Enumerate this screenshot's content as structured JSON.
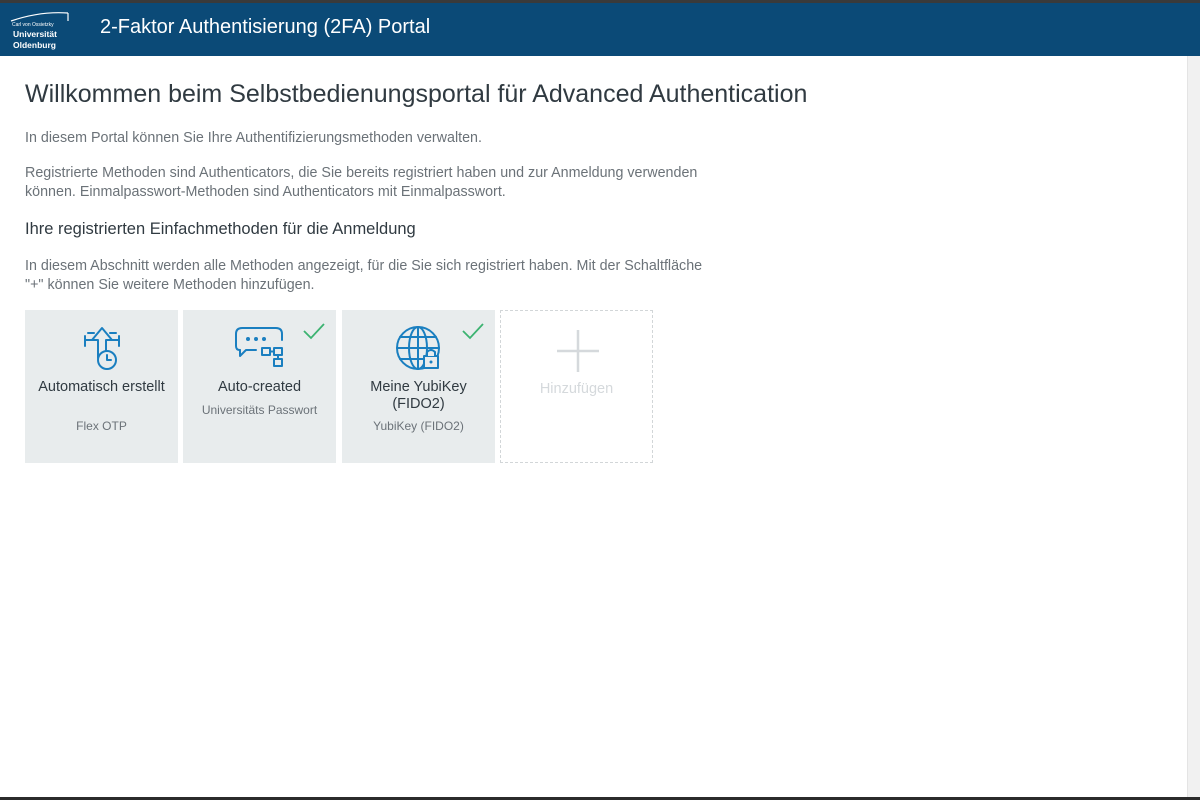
{
  "header": {
    "logo": {
      "line1": "Carl von Ossietzky",
      "line2": "Universität",
      "line3": "Oldenburg"
    },
    "title": "2-Faktor Authentisierung (2FA) Portal"
  },
  "main": {
    "heading": "Willkommen beim Selbstbedienungsportal für Advanced Authentication",
    "intro": "In diesem Portal können Sie Ihre Authentifizierungsmethoden verwalten.",
    "description": "Registrierte Methoden sind Authenticators, die Sie bereits registriert haben und zur Anmeldung verwenden können. Einmalpasswort-Methoden sind Authenticators mit Einmalpasswort.",
    "section_heading": "Ihre registrierten Einfachmethoden für die Anmeldung",
    "section_text": "In diesem Abschnitt werden alle Methoden angezeigt, für die Sie sich registriert haben. Mit der Schaltfläche \"+\" können Sie weitere Methoden hinzufügen.",
    "cards": [
      {
        "title": "Automatisch erstellt",
        "subtitle": "Flex OTP",
        "icon": "flex-otp-icon",
        "checked": false
      },
      {
        "title": "Auto-created",
        "subtitle": "Universitäts Passwort",
        "icon": "password-icon",
        "checked": true
      },
      {
        "title": "Meine YubiKey (FIDO2)",
        "subtitle": "YubiKey (FIDO2)",
        "icon": "fido-globe-icon",
        "checked": true
      }
    ],
    "add_card": {
      "label": "Hinzufügen",
      "icon": "plus-icon"
    }
  },
  "colors": {
    "header_bg": "#0b4a77",
    "icon_blue": "#1a7fc0",
    "check_green": "#3cb371",
    "card_bg": "#e8eced"
  }
}
